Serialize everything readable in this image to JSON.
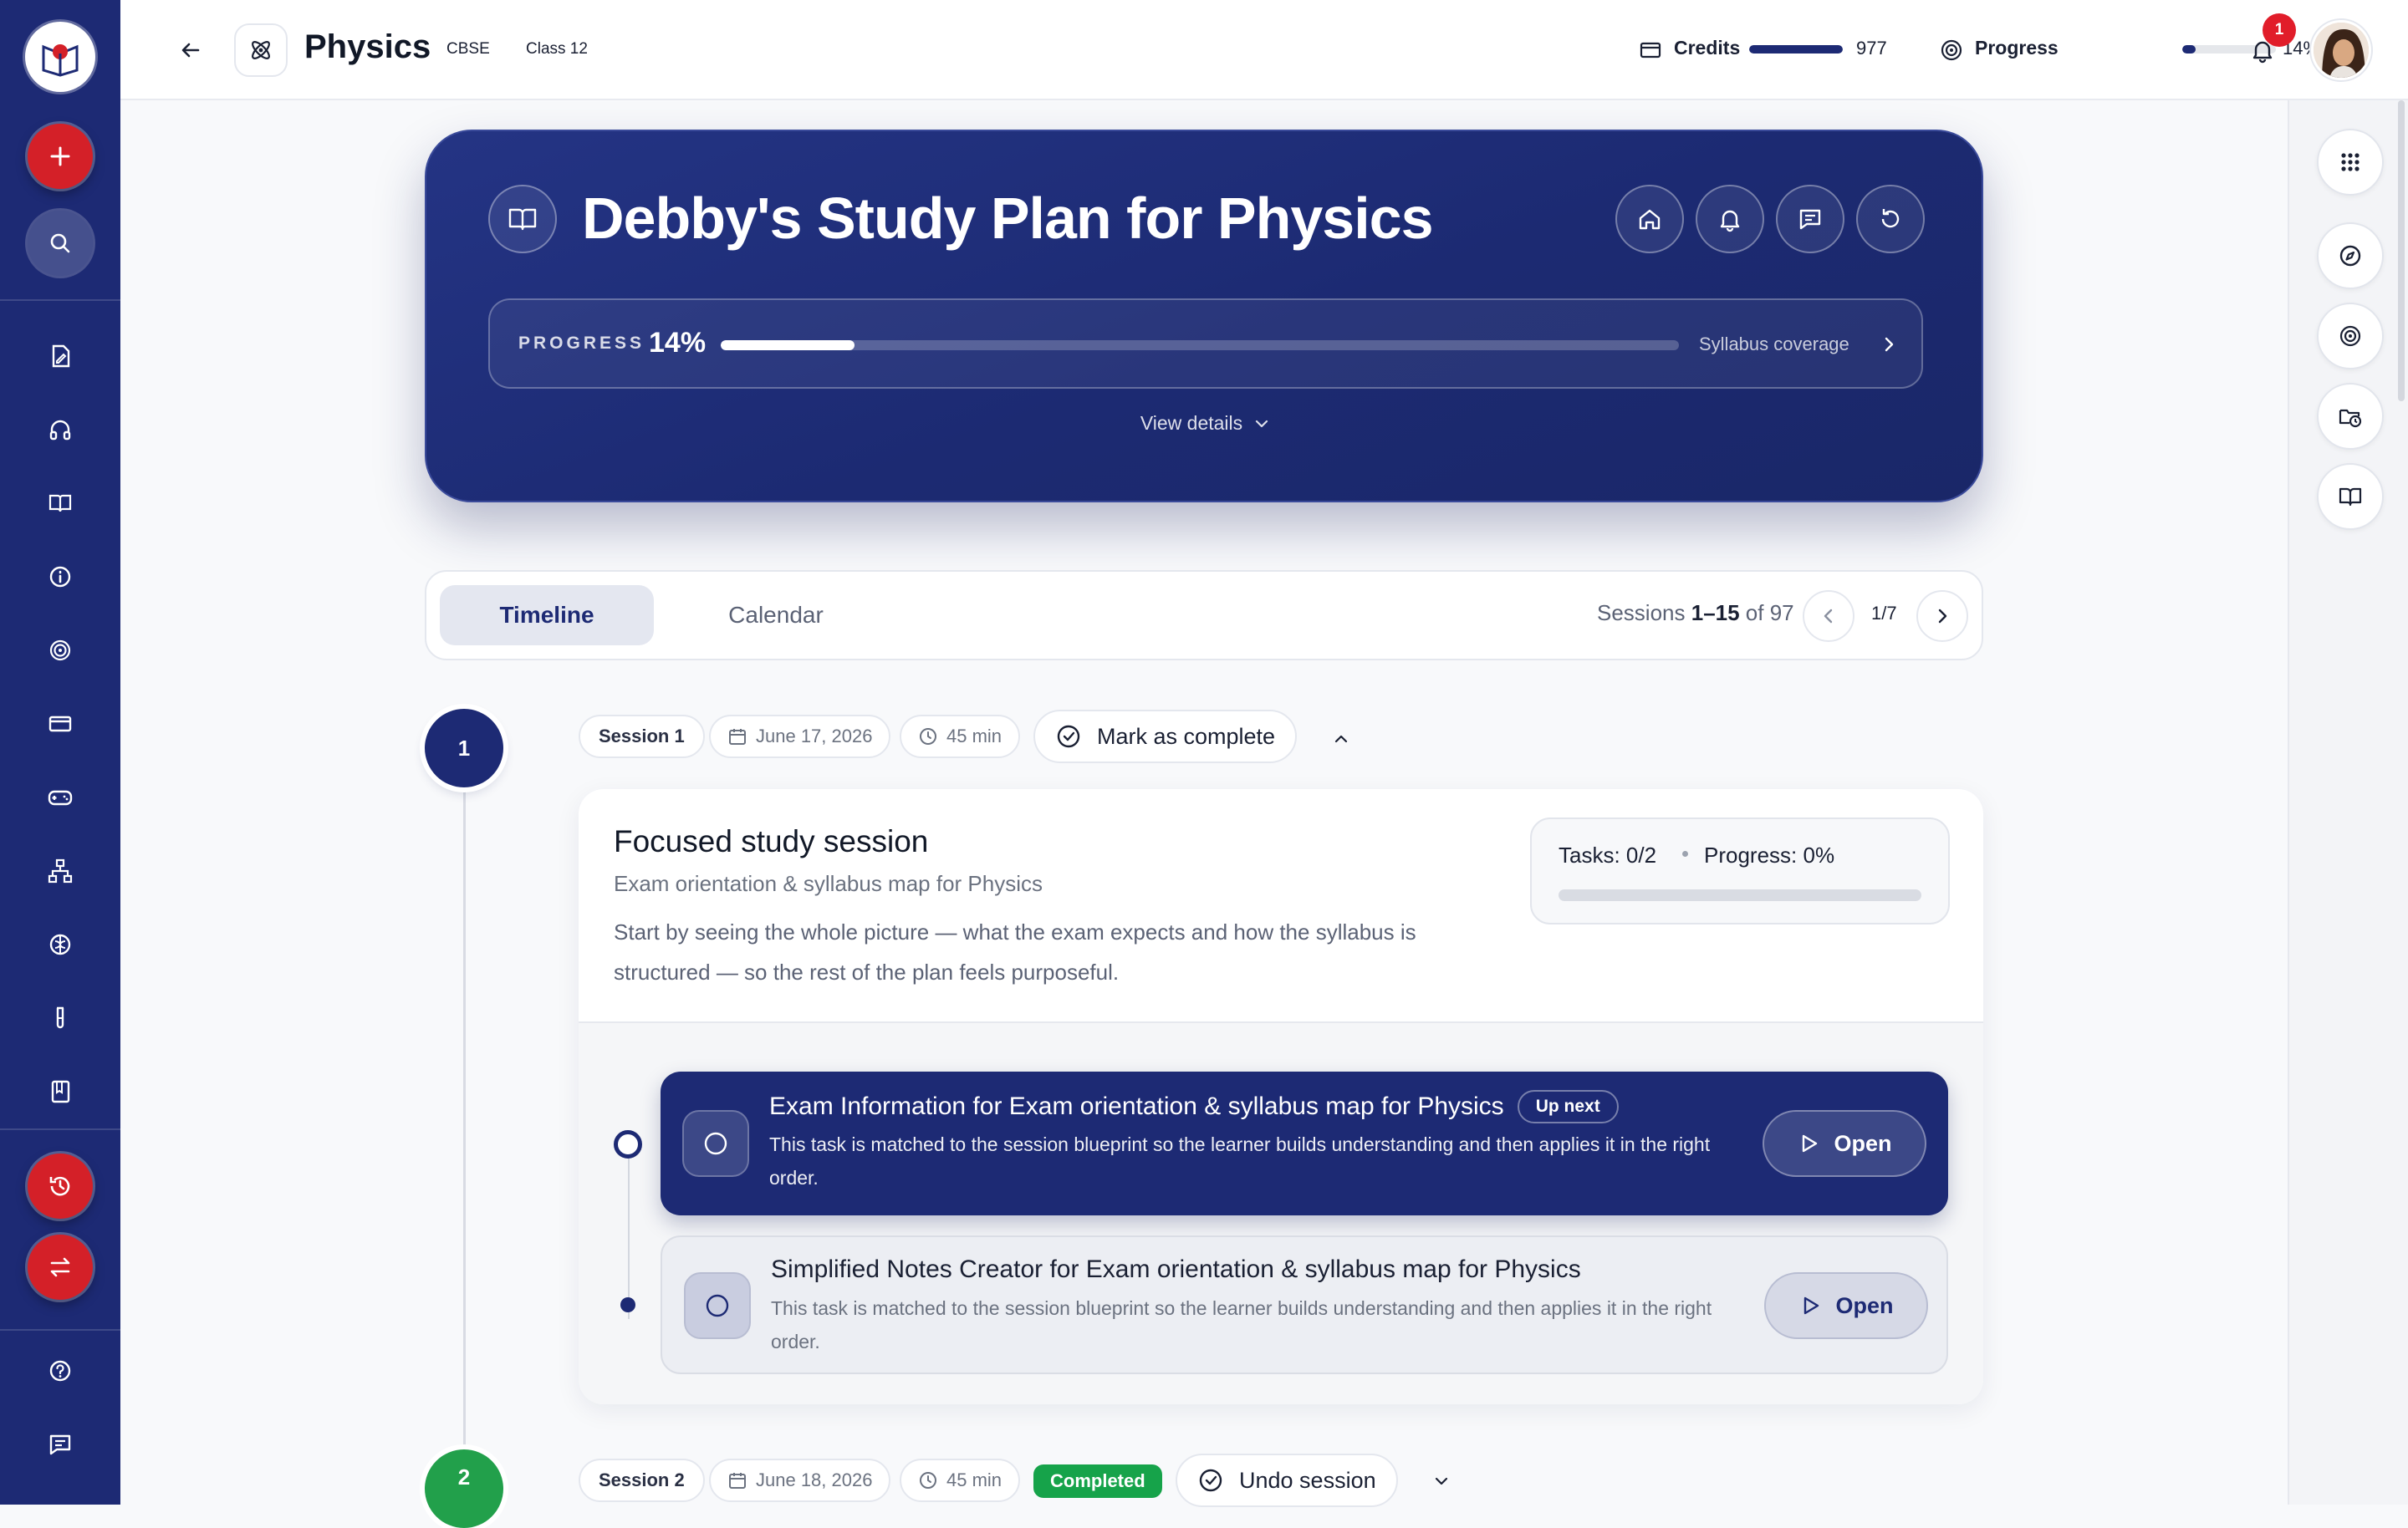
{
  "header": {
    "subject": "Physics",
    "board": "CBSE",
    "class": "Class 12",
    "credits_label": "Credits",
    "credits_value": "977",
    "credits_fraction": 1.0,
    "progress_label": "Progress",
    "progress_value": "14%",
    "progress_fraction": 0.14,
    "notification_count": "1"
  },
  "hero": {
    "title": "Debby's Study Plan for Physics",
    "progress_label": "PROGRESS",
    "progress_value": "14%",
    "progress_fraction": 0.14,
    "coverage_label": "Syllabus coverage",
    "view_details": "View details"
  },
  "tabs": {
    "items": [
      "Timeline",
      "Calendar"
    ],
    "active": "Timeline",
    "sessions_prefix": "Sessions ",
    "sessions_range": "1–15",
    "sessions_of": " of 97",
    "page": "1/7"
  },
  "sessions": [
    {
      "number": "1",
      "label": "Session 1",
      "date": "June 17, 2026",
      "duration": "45 min",
      "action": "Mark as complete",
      "title": "Focused study session",
      "subtitle": "Exam orientation & syllabus map for Physics",
      "description_line1": "Start by seeing the whole picture — what the exam expects and how the syllabus is",
      "description_line2": "structured — so the rest of the plan feels purposeful.",
      "tasks_stat": "Tasks: 0/2",
      "progress_stat": "Progress: 0%",
      "progress_fraction": 0.0,
      "tasks": [
        {
          "title": "Exam Information for Exam orientation & syllabus map for Physics",
          "badge": "Up next",
          "desc_line1": "This task is matched to the session blueprint so the learner builds understanding and then applies it in the right",
          "desc_line2": "order.",
          "button": "Open"
        },
        {
          "title": "Simplified Notes Creator for Exam orientation & syllabus map for Physics",
          "desc_line1": "This task is matched to the session blueprint so the learner builds understanding and then applies it in the right",
          "desc_line2": "order.",
          "button": "Open"
        }
      ]
    },
    {
      "number": "2",
      "label": "Session 2",
      "date": "June 18, 2026",
      "duration": "45 min",
      "status": "Completed",
      "action": "Undo session"
    }
  ],
  "colors": {
    "navy": "#1d2a74",
    "accent_red": "#d42028",
    "success_green": "#16a34a"
  },
  "icons": {
    "sidebar": [
      "logo-icon",
      "plus-icon",
      "search-icon",
      "edit-doc-icon",
      "headphones-icon",
      "book-icon",
      "info-icon",
      "target-icon",
      "card-icon",
      "gamepad-icon",
      "hierarchy-icon",
      "brain-icon",
      "test-tube-icon",
      "notebook-icon",
      "history-icon",
      "swap-icon",
      "help-icon",
      "chat-icon"
    ],
    "rail": [
      "apps-grid-icon",
      "compass-icon",
      "target-icon",
      "folder-clock-icon",
      "book-open-icon"
    ]
  }
}
